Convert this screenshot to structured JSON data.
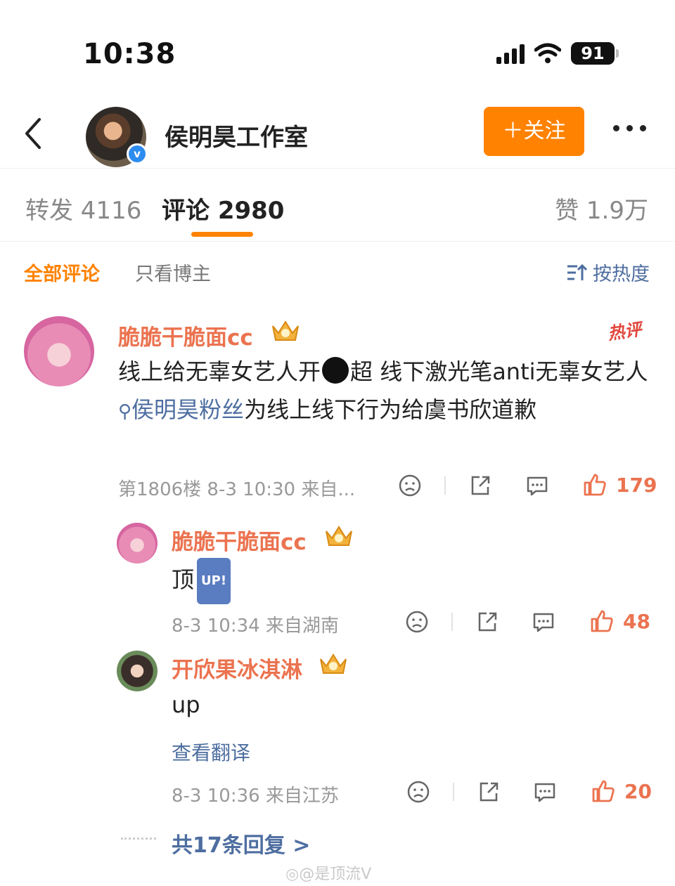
{
  "status_bar": {
    "time": "10:38",
    "battery": "91"
  },
  "header": {
    "title": "侯明昊工作室",
    "follow_label": "＋关注",
    "verified_mark": "v"
  },
  "tabs": {
    "repost": "转发 4116",
    "comments": "评论 2980",
    "likes": "赞 1.9万",
    "active": "comments"
  },
  "filters": {
    "all": "全部评论",
    "author_only": "只看博主",
    "sort": "按热度"
  },
  "comments": [
    {
      "username": "脆脆干脆面cc",
      "hot_badge": "热评",
      "text_part1": "线上给无辜女艺人开",
      "text_part2": "超 线下激光笔anti无辜女艺人 ",
      "topic": "侯明昊粉丝",
      "text_part3": "为线上线下行为给虞书欣道歉",
      "meta": "第1806楼 8-3 10:30 来自...",
      "likes": "179"
    }
  ],
  "replies": [
    {
      "username": "脆脆干脆面cc",
      "text": "顶",
      "badge": "UP!",
      "meta": "8-3 10:34 来自湖南",
      "likes": "48"
    },
    {
      "username": "开欣果冰淇淋",
      "text": "up",
      "translate": "查看翻译",
      "meta": "8-3 10:36 来自江苏",
      "likes": "20"
    }
  ],
  "more_replies": "共17条回复 >",
  "watermark": "@是顶流V",
  "colors": {
    "accent": "#ff8200",
    "username": "#eb7350",
    "link": "#4e6ea0"
  },
  "icons": [
    "back-icon",
    "verified-icon",
    "more-icon",
    "sort-icon",
    "crown-icon",
    "search-icon",
    "dislike-icon",
    "share-icon",
    "comment-icon",
    "like-icon",
    "weibo-icon"
  ]
}
